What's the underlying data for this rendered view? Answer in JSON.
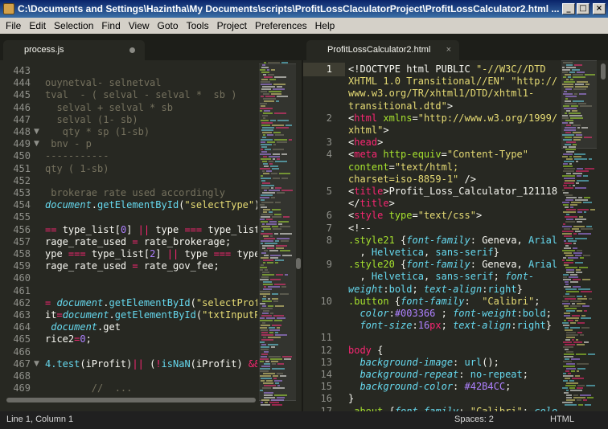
{
  "window": {
    "title": "C:\\Documents and Settings\\Hazintha\\My Documents\\scripts\\ProfitLossClaculatorProject\\ProfitLossCalculator2.html ...",
    "minimize": "_",
    "maximize": "□",
    "close": "×"
  },
  "menu": [
    "File",
    "Edit",
    "Selection",
    "Find",
    "View",
    "Goto",
    "Tools",
    "Project",
    "Preferences",
    "Help"
  ],
  "tabs": {
    "left": {
      "label": "process.js"
    },
    "right": {
      "label": "ProfitLossCalculator2.html",
      "close": "×"
    }
  },
  "left_pane": {
    "lines": [
      {
        "num": "443",
        "segs": [
          {
            "t": "",
            "c": ""
          }
        ]
      },
      {
        "num": "444",
        "segs": [
          {
            "t": "ouynetval- selnetval",
            "c": "cm"
          }
        ]
      },
      {
        "num": "445",
        "segs": [
          {
            "t": "tval  - ( selval - selval *  sb )",
            "c": "cm"
          }
        ]
      },
      {
        "num": "446",
        "segs": [
          {
            "t": "  selval + selval * sb",
            "c": "cm"
          }
        ]
      },
      {
        "num": "447",
        "segs": [
          {
            "t": "  selval (1- sb)",
            "c": "cm"
          }
        ]
      },
      {
        "num": "448",
        "fold": "▼",
        "segs": [
          {
            "t": "   qty * sp (1-sb)",
            "c": "cm"
          }
        ]
      },
      {
        "num": "449",
        "fold": "▼",
        "segs": [
          {
            "t": " bnv - p",
            "c": "cm"
          }
        ]
      },
      {
        "num": "450",
        "segs": [
          {
            "t": "-----------",
            "c": "cm"
          }
        ]
      },
      {
        "num": "451",
        "segs": [
          {
            "t": "qty ( 1-sb)",
            "c": "cm"
          }
        ]
      },
      {
        "num": "452",
        "segs": [
          {
            "t": "",
            "c": ""
          }
        ]
      },
      {
        "num": "453",
        "segs": [
          {
            "t": " brokerae rate used accordingly",
            "c": "cm"
          }
        ]
      },
      {
        "num": "454",
        "segs": [
          {
            "t": "document",
            "c": "ital"
          },
          {
            "t": ".",
            "c": ""
          },
          {
            "t": "getElementById",
            "c": "blue"
          },
          {
            "t": "(",
            "c": ""
          },
          {
            "t": "\"selectType\"",
            "c": "str"
          },
          {
            "t": ").va",
            "c": ""
          }
        ]
      },
      {
        "num": "455",
        "segs": [
          {
            "t": "",
            "c": ""
          }
        ]
      },
      {
        "num": "456",
        "segs": [
          {
            "t": "== ",
            "c": "kw"
          },
          {
            "t": "type_list[",
            "c": ""
          },
          {
            "t": "0",
            "c": "num"
          },
          {
            "t": "] ",
            "c": ""
          },
          {
            "t": "|| ",
            "c": "kw"
          },
          {
            "t": "type ",
            "c": ""
          },
          {
            "t": "=== ",
            "c": "kw"
          },
          {
            "t": "type_list[",
            "c": ""
          }
        ]
      },
      {
        "num": "457",
        "segs": [
          {
            "t": "rage_rate_used ",
            "c": ""
          },
          {
            "t": "= ",
            "c": "kw"
          },
          {
            "t": "rate_brokerage;",
            "c": ""
          }
        ]
      },
      {
        "num": "458",
        "segs": [
          {
            "t": "ype ",
            "c": ""
          },
          {
            "t": "=== ",
            "c": "kw"
          },
          {
            "t": "type_list[",
            "c": ""
          },
          {
            "t": "2",
            "c": "num"
          },
          {
            "t": "] ",
            "c": ""
          },
          {
            "t": "|| ",
            "c": "kw"
          },
          {
            "t": "type ",
            "c": ""
          },
          {
            "t": "=== ",
            "c": "kw"
          },
          {
            "t": "type_",
            "c": ""
          }
        ]
      },
      {
        "num": "459",
        "segs": [
          {
            "t": "rage_rate_used ",
            "c": ""
          },
          {
            "t": "= ",
            "c": "kw"
          },
          {
            "t": "rate_gov_fee;",
            "c": ""
          }
        ]
      },
      {
        "num": "460",
        "segs": [
          {
            "t": "",
            "c": ""
          }
        ]
      },
      {
        "num": "461",
        "segs": [
          {
            "t": "",
            "c": ""
          }
        ]
      },
      {
        "num": "462",
        "segs": [
          {
            "t": "= ",
            "c": "kw"
          },
          {
            "t": "document",
            "c": "ital"
          },
          {
            "t": ".",
            "c": ""
          },
          {
            "t": "getElementById",
            "c": "blue"
          },
          {
            "t": "(",
            "c": ""
          },
          {
            "t": "\"selectProfi",
            "c": "str"
          }
        ]
      },
      {
        "num": "463",
        "segs": [
          {
            "t": "it",
            "c": ""
          },
          {
            "t": "=",
            "c": "kw"
          },
          {
            "t": "document",
            "c": "ital"
          },
          {
            "t": ".",
            "c": ""
          },
          {
            "t": "getElementById",
            "c": "blue"
          },
          {
            "t": "(",
            "c": ""
          },
          {
            "t": "\"txtInputPr",
            "c": "str"
          }
        ]
      },
      {
        "num": "464",
        "segs": [
          {
            "t": " document",
            "c": "ital"
          },
          {
            "t": ".get",
            "c": ""
          }
        ]
      },
      {
        "num": "465",
        "segs": [
          {
            "t": "rice2",
            "c": ""
          },
          {
            "t": "=",
            "c": "kw"
          },
          {
            "t": "0",
            "c": "num"
          },
          {
            "t": ";",
            "c": ""
          }
        ]
      },
      {
        "num": "466",
        "segs": [
          {
            "t": "",
            "c": ""
          }
        ]
      },
      {
        "num": "467",
        "fold": "▼",
        "segs": [
          {
            "t": "4.test",
            "c": "blue"
          },
          {
            "t": "(iProfit)",
            "c": ""
          },
          {
            "t": "|| ",
            "c": "kw"
          },
          {
            "t": "(",
            "c": ""
          },
          {
            "t": "!",
            "c": "kw"
          },
          {
            "t": "isNaN",
            "c": "blue"
          },
          {
            "t": "(iProfit) ",
            "c": ""
          },
          {
            "t": "&&",
            "c": "kw"
          }
        ]
      },
      {
        "num": "468",
        "segs": [
          {
            "t": "",
            "c": ""
          }
        ]
      },
      {
        "num": "469",
        "segs": [
          {
            "t": "        ",
            "c": ""
          },
          {
            "t": "//  ",
            "c": "cm"
          },
          {
            "t": "...",
            "c": "cm"
          }
        ]
      }
    ]
  },
  "right_pane": {
    "lines": [
      {
        "num": "1",
        "rows": [
          [
            {
              "t": "<!DOCTYPE html PUBLIC ",
              "c": ""
            },
            {
              "t": "\"-//W3C//DTD",
              "c": "str"
            }
          ],
          [
            {
              "t": "XHTML 1.0 Transitional//EN\" \"http://",
              "c": "str"
            }
          ],
          [
            {
              "t": "www.w3.org/TR/xhtml1/DTD/xhtml1-",
              "c": "str"
            }
          ],
          [
            {
              "t": "transitional.dtd\"",
              "c": "str"
            },
            {
              "t": ">",
              "c": ""
            }
          ]
        ]
      },
      {
        "num": "2",
        "rows": [
          [
            {
              "t": "<",
              "c": ""
            },
            {
              "t": "html ",
              "c": "kw"
            },
            {
              "t": "xmlns",
              "c": "attr"
            },
            {
              "t": "=",
              "c": ""
            },
            {
              "t": "\"http://www.w3.org/1999/",
              "c": "str"
            }
          ],
          [
            {
              "t": "xhtml\"",
              "c": "str"
            },
            {
              "t": ">",
              "c": ""
            }
          ]
        ]
      },
      {
        "num": "3",
        "rows": [
          [
            {
              "t": "<",
              "c": ""
            },
            {
              "t": "head",
              "c": "kw"
            },
            {
              "t": ">",
              "c": ""
            }
          ]
        ]
      },
      {
        "num": "4",
        "rows": [
          [
            {
              "t": "<",
              "c": ""
            },
            {
              "t": "meta ",
              "c": "kw"
            },
            {
              "t": "http-equiv",
              "c": "attr"
            },
            {
              "t": "=",
              "c": ""
            },
            {
              "t": "\"Content-Type\"",
              "c": "str"
            }
          ],
          [
            {
              "t": "content",
              "c": "attr"
            },
            {
              "t": "=",
              "c": ""
            },
            {
              "t": "\"text/html;",
              "c": "str"
            }
          ],
          [
            {
              "t": "charset=iso-8859-1\"",
              "c": "str"
            },
            {
              "t": " />",
              "c": ""
            }
          ]
        ]
      },
      {
        "num": "5",
        "rows": [
          [
            {
              "t": "<",
              "c": ""
            },
            {
              "t": "title",
              "c": "kw"
            },
            {
              "t": ">Profit_Loss_Calculator_121118",
              "c": ""
            }
          ],
          [
            {
              "t": "</",
              "c": ""
            },
            {
              "t": "title",
              "c": "kw"
            },
            {
              "t": ">",
              "c": ""
            }
          ]
        ]
      },
      {
        "num": "6",
        "rows": [
          [
            {
              "t": "<",
              "c": ""
            },
            {
              "t": "style ",
              "c": "kw"
            },
            {
              "t": "type",
              "c": "attr"
            },
            {
              "t": "=",
              "c": ""
            },
            {
              "t": "\"text/css\"",
              "c": "str"
            },
            {
              "t": ">",
              "c": ""
            }
          ]
        ]
      },
      {
        "num": "7",
        "rows": [
          [
            {
              "t": "<!--",
              "c": ""
            }
          ]
        ]
      },
      {
        "num": "8",
        "rows": [
          [
            {
              "t": ".style21 ",
              "c": "fn"
            },
            {
              "t": "{",
              "c": ""
            },
            {
              "t": "font-family",
              "c": "ital"
            },
            {
              "t": ": Geneva, ",
              "c": ""
            },
            {
              "t": "Arial",
              "c": "blue"
            }
          ],
          [
            {
              "t": "  , ",
              "c": ""
            },
            {
              "t": "Helvetica",
              "c": "blue"
            },
            {
              "t": ", ",
              "c": ""
            },
            {
              "t": "sans-serif",
              "c": "blue"
            },
            {
              "t": "}",
              "c": ""
            }
          ]
        ]
      },
      {
        "num": "9",
        "rows": [
          [
            {
              "t": ".style20 ",
              "c": "fn"
            },
            {
              "t": "{",
              "c": ""
            },
            {
              "t": "font-family",
              "c": "ital"
            },
            {
              "t": ": Geneva, ",
              "c": ""
            },
            {
              "t": "Arial",
              "c": "blue"
            }
          ],
          [
            {
              "t": "  , ",
              "c": ""
            },
            {
              "t": "Helvetica",
              "c": "blue"
            },
            {
              "t": ", ",
              "c": ""
            },
            {
              "t": "sans-serif",
              "c": "blue"
            },
            {
              "t": "; ",
              "c": ""
            },
            {
              "t": "font-",
              "c": "ital"
            }
          ],
          [
            {
              "t": "weight",
              "c": "ital"
            },
            {
              "t": ":",
              "c": ""
            },
            {
              "t": "bold",
              "c": "blue"
            },
            {
              "t": "; ",
              "c": ""
            },
            {
              "t": "text-align",
              "c": "ital"
            },
            {
              "t": ":",
              "c": ""
            },
            {
              "t": "right",
              "c": "blue"
            },
            {
              "t": "}",
              "c": ""
            }
          ]
        ]
      },
      {
        "num": "10",
        "rows": [
          [
            {
              "t": ".button ",
              "c": "fn"
            },
            {
              "t": "{",
              "c": ""
            },
            {
              "t": "font-family",
              "c": "ital"
            },
            {
              "t": ":  ",
              "c": ""
            },
            {
              "t": "\"Calibri\"",
              "c": "str"
            },
            {
              "t": ";",
              "c": ""
            }
          ],
          [
            {
              "t": "  color",
              "c": "ital"
            },
            {
              "t": ":",
              "c": ""
            },
            {
              "t": "#003366",
              "c": "num"
            },
            {
              "t": " ; ",
              "c": ""
            },
            {
              "t": "font-weight",
              "c": "ital"
            },
            {
              "t": ":",
              "c": ""
            },
            {
              "t": "bold",
              "c": "blue"
            },
            {
              "t": ";",
              "c": ""
            }
          ],
          [
            {
              "t": "  font-size",
              "c": "ital"
            },
            {
              "t": ":",
              "c": ""
            },
            {
              "t": "16",
              "c": "num"
            },
            {
              "t": "px",
              "c": "kw"
            },
            {
              "t": "; ",
              "c": ""
            },
            {
              "t": "text-align",
              "c": "ital"
            },
            {
              "t": ":",
              "c": ""
            },
            {
              "t": "right",
              "c": "blue"
            },
            {
              "t": "}",
              "c": ""
            }
          ]
        ]
      },
      {
        "num": "11",
        "rows": [
          [
            {
              "t": "",
              "c": ""
            }
          ]
        ]
      },
      {
        "num": "12",
        "rows": [
          [
            {
              "t": "body ",
              "c": "kw"
            },
            {
              "t": "{",
              "c": ""
            }
          ]
        ]
      },
      {
        "num": "13",
        "rows": [
          [
            {
              "t": "  background-image",
              "c": "ital"
            },
            {
              "t": ": ",
              "c": ""
            },
            {
              "t": "url",
              "c": "blue"
            },
            {
              "t": "();",
              "c": ""
            }
          ]
        ]
      },
      {
        "num": "14",
        "rows": [
          [
            {
              "t": "  background-repeat",
              "c": "ital"
            },
            {
              "t": ": ",
              "c": ""
            },
            {
              "t": "no-repeat",
              "c": "blue"
            },
            {
              "t": ";",
              "c": ""
            }
          ]
        ]
      },
      {
        "num": "15",
        "rows": [
          [
            {
              "t": "  background-color",
              "c": "ital"
            },
            {
              "t": ": ",
              "c": ""
            },
            {
              "t": "#42B4CC",
              "c": "num"
            },
            {
              "t": ";",
              "c": ""
            }
          ]
        ]
      },
      {
        "num": "16",
        "rows": [
          [
            {
              "t": "}",
              "c": ""
            }
          ]
        ]
      },
      {
        "num": "17",
        "rows": [
          [
            {
              "t": ".about ",
              "c": "fn"
            },
            {
              "t": "{",
              "c": ""
            },
            {
              "t": "font-family",
              "c": "ital"
            },
            {
              "t": ": ",
              "c": ""
            },
            {
              "t": "\"Calibri\"",
              "c": "str"
            },
            {
              "t": "; ",
              "c": ""
            },
            {
              "t": "color",
              "c": "ital"
            }
          ]
        ]
      }
    ]
  },
  "status": {
    "position": "Line 1, Column 1",
    "spaces": "Spaces: 2",
    "syntax": "HTML"
  }
}
